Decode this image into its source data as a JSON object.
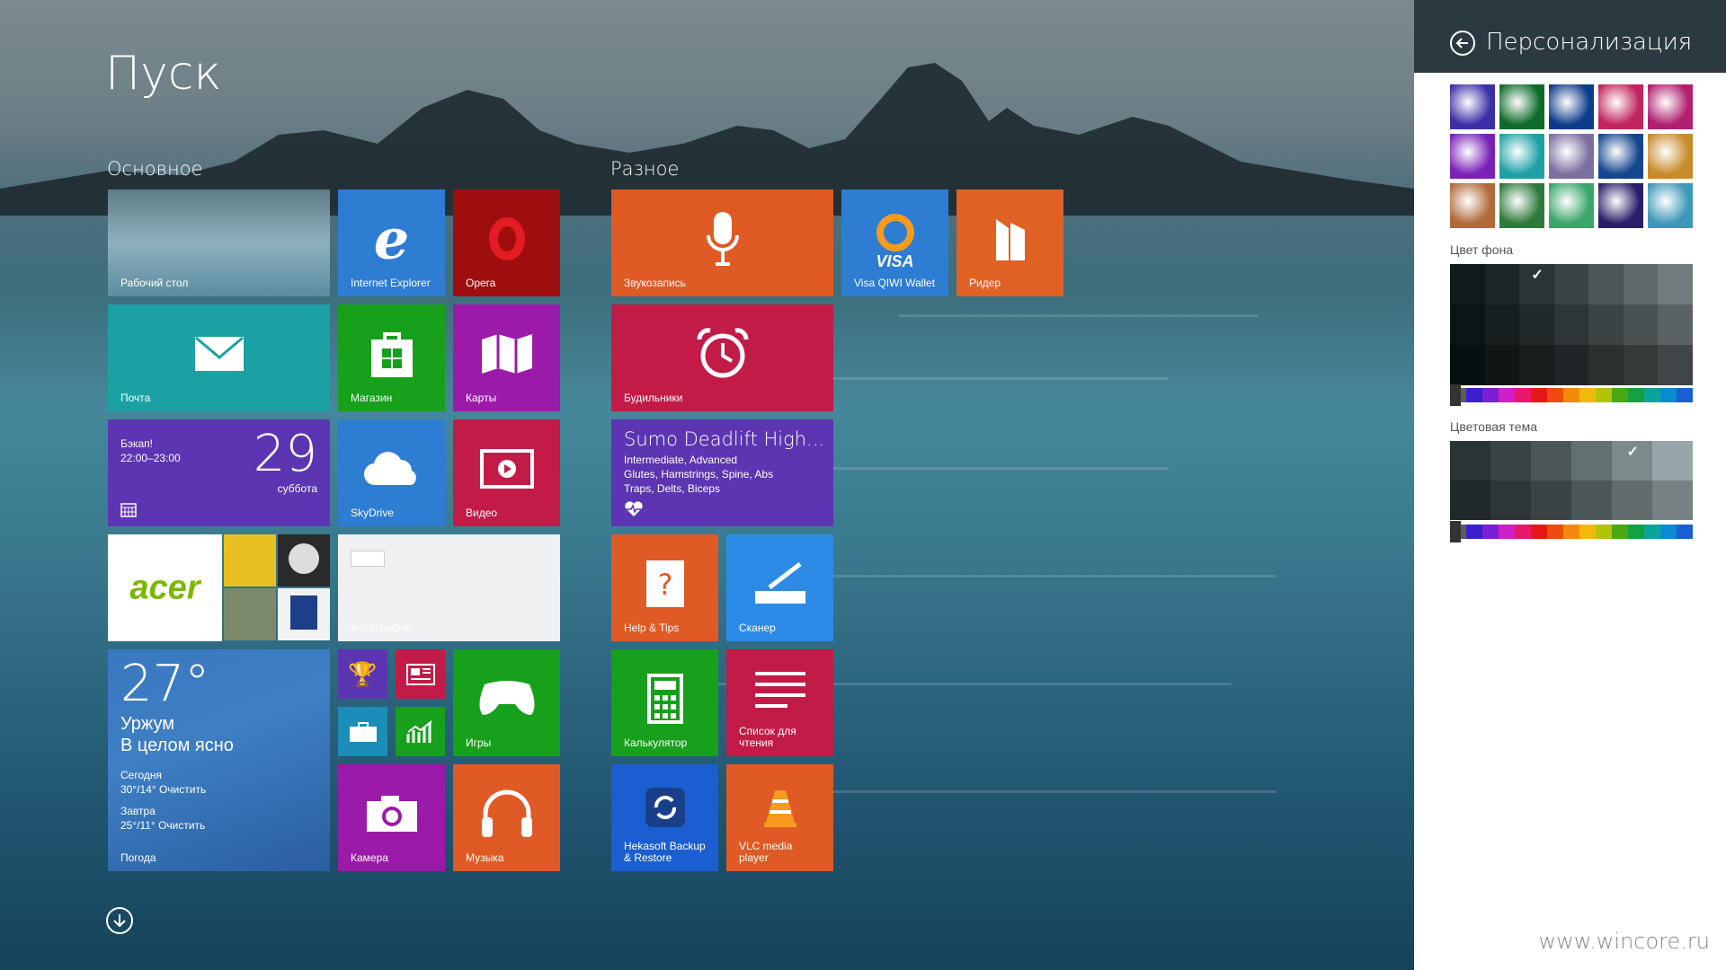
{
  "start": {
    "title": "Пуск",
    "scroll_icon": "arrow-down-circle-icon"
  },
  "groups": {
    "main": "Основное",
    "misc": "Разное"
  },
  "tiles": {
    "desktop": "Рабочий стол",
    "ie": "Internet Explorer",
    "opera": "Opera",
    "mail": "Почта",
    "store": "Магазин",
    "maps": "Карты",
    "calendar": {
      "event": "Бэкап!",
      "time": "22:00–23:00",
      "day": "29",
      "weekday": "суббота"
    },
    "skydrive": "SkyDrive",
    "video": "Видео",
    "acer": "acer",
    "photos": "Фотографии",
    "weather": {
      "temp": "27°",
      "city": "Уржум",
      "condition": "В целом ясно",
      "today_label": "Сегодня",
      "today": "30°/14° Очистить",
      "tomorrow_label": "Завтра",
      "tomorrow": "25°/11° Очистить",
      "app": "Погода"
    },
    "games": "Игры",
    "camera": "Камера",
    "music": "Музыка",
    "recorder": "Звукозапись",
    "qiwi": "Visa QIWI Wallet",
    "reader": "Ридер",
    "alarms": "Будильники",
    "health": {
      "title": "Sumo Deadlift High...",
      "line1": "Intermediate, Advanced",
      "line2": "Glutes, Hamstrings, Spine, Abs",
      "line3": "Traps, Delts, Biceps"
    },
    "help": "Help & Tips",
    "scanner": "Сканер",
    "calculator": "Калькулятор",
    "reading_list": "Список для\nчтения",
    "hekasoft": "Hekasoft Backup\n& Restore",
    "vlc": "VLC media\nplayer"
  },
  "panel": {
    "title": "Персонализация",
    "background_color_label": "Цвет фона",
    "theme_color_label": "Цветовая тема",
    "pattern_colors": [
      "#3b2fa8",
      "#0e6b2a",
      "#0e3c8a",
      "#c2245e",
      "#b0206f",
      "#7a22b8",
      "#1ea0a6",
      "#7a6fa0",
      "#14468e",
      "#c88a2a",
      "#b06a3a",
      "#2e7a3c",
      "#3aa66a",
      "#2a1e6a",
      "#3f98b8"
    ],
    "bg_palette": [
      "#0f1a1c",
      "#1c2628",
      "#2a3436",
      "#3a4446",
      "#4c5658",
      "#5e686a",
      "#727c7e"
    ],
    "theme_palette": [
      "#2a3436",
      "#3a4446",
      "#4c5658",
      "#627072",
      "#7c8a8c",
      "#97a6a8"
    ],
    "hues": [
      "#5c5c5c",
      "#3b1fd1",
      "#7a1fd1",
      "#d11fc5",
      "#e8176a",
      "#e81717",
      "#f04a10",
      "#f28a0b",
      "#f2b90b",
      "#b0c40a",
      "#4aa812",
      "#13a142",
      "#0aa59a",
      "#0a8ad1",
      "#1a5fd1"
    ],
    "watermark": "www.wincore.ru"
  }
}
